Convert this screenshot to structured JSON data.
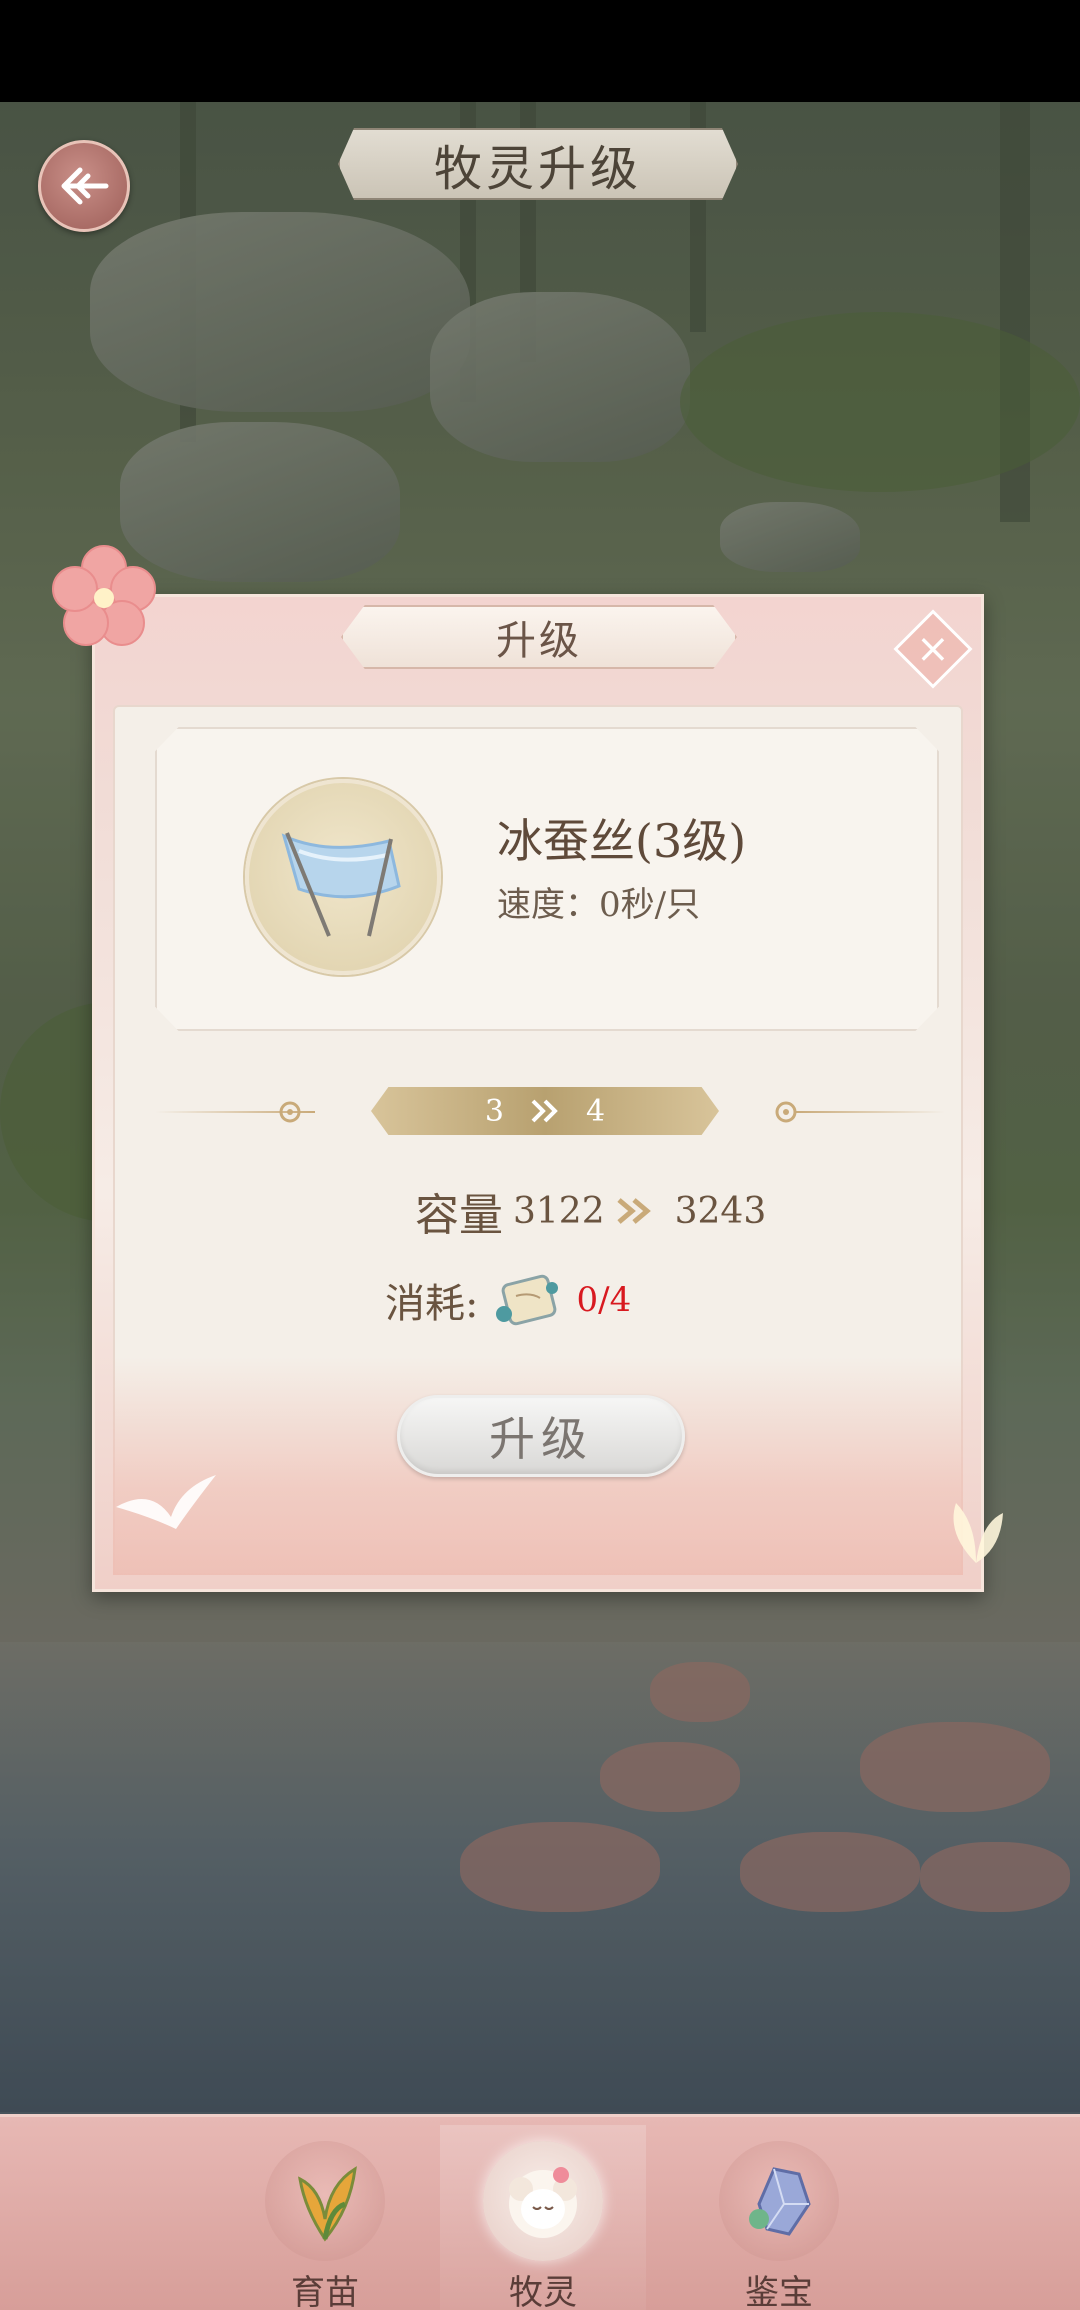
{
  "header": {
    "title": "牧灵升级"
  },
  "dialog": {
    "title": "升级",
    "item": {
      "name": "冰蚕丝(3级)",
      "speed": "速度：0秒/只"
    },
    "level": {
      "from": "3",
      "to": "4"
    },
    "capacity": {
      "label": "容量",
      "from": "3122",
      "to": "3243"
    },
    "cost": {
      "label": "消耗:",
      "value": "0/4"
    },
    "upgrade_label": "升级"
  },
  "nav": {
    "tabs": [
      {
        "label": "育苗"
      },
      {
        "label": "牧灵",
        "active": true
      },
      {
        "label": "鉴宝"
      }
    ]
  },
  "colors": {
    "accent_pink": "#e7b8b4",
    "cost_red": "#d8191f",
    "gold": "#b8a170"
  }
}
